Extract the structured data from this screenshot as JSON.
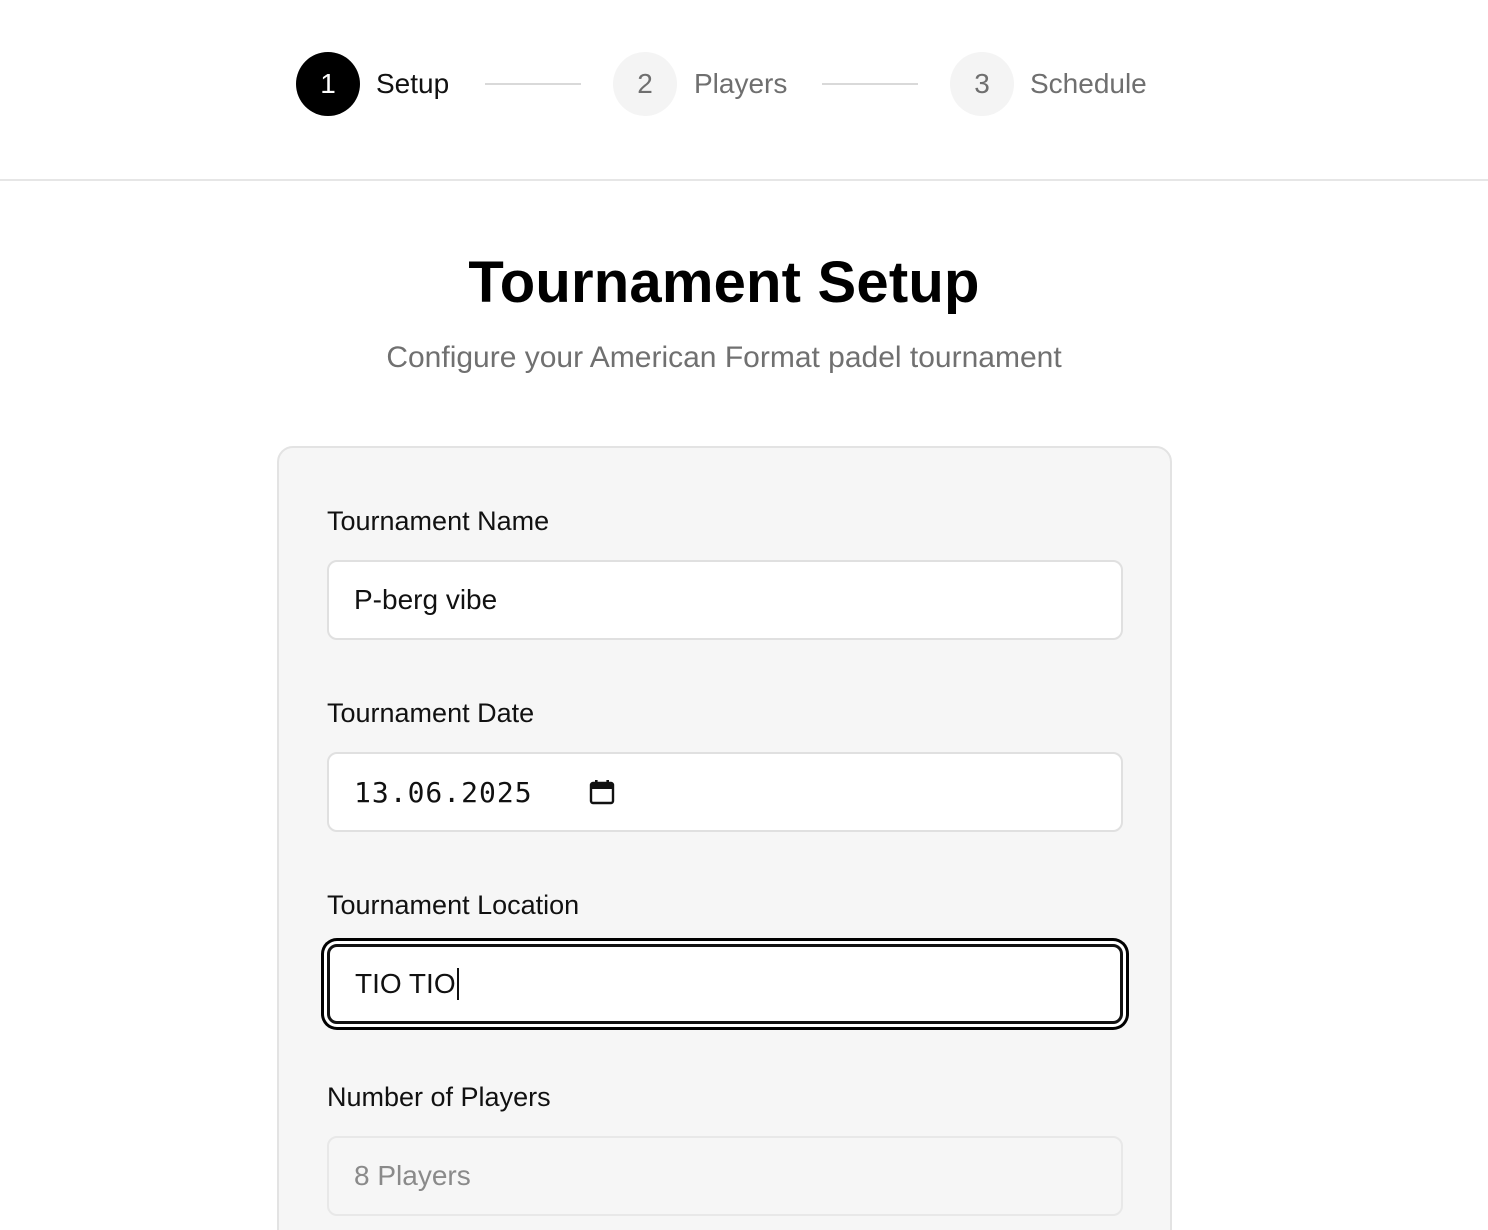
{
  "stepper": {
    "steps": [
      {
        "number": "1",
        "label": "Setup",
        "state": "active"
      },
      {
        "number": "2",
        "label": "Players",
        "state": "inactive"
      },
      {
        "number": "3",
        "label": "Schedule",
        "state": "inactive"
      }
    ]
  },
  "header": {
    "title": "Tournament Setup",
    "subtitle": "Configure your American Format padel tournament"
  },
  "form": {
    "name": {
      "label": "Tournament Name",
      "value": "P-berg vibe"
    },
    "date": {
      "label": "Tournament Date",
      "value": "13.06.2025",
      "icon": "calendar-icon"
    },
    "location": {
      "label": "Tournament Location",
      "value": "TIO TIO",
      "focused": true
    },
    "players": {
      "label": "Number of Players",
      "value": "8 Players",
      "disabled": true
    }
  },
  "colors": {
    "accent": "#000000",
    "inactive_step_bg": "#f4f4f4",
    "muted_text": "#6f6f6f",
    "card_bg": "#f6f6f6"
  }
}
